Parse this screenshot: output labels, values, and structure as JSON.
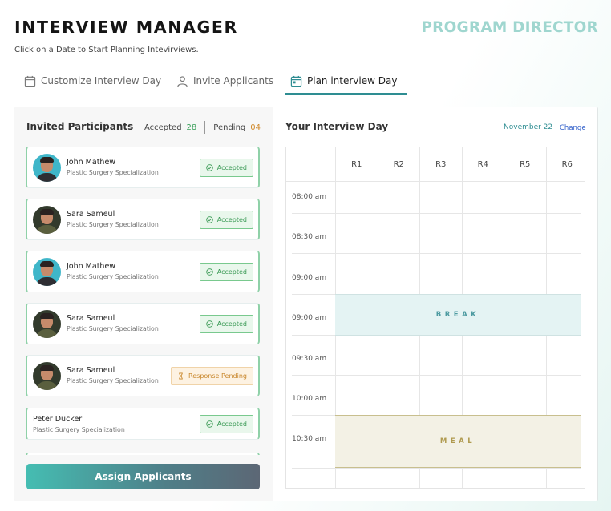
{
  "header": {
    "title": "INTERVIEW MANAGER",
    "role": "PROGRAM DIRECTOR",
    "subtitle": "Click on a Date to Start Planning Intevirviews."
  },
  "tabs": [
    {
      "label": "Customize Interview Day",
      "icon": "calendar-icon",
      "active": false
    },
    {
      "label": "Invite Applicants",
      "icon": "user-icon",
      "active": false
    },
    {
      "label": "Plan interview Day",
      "icon": "calendar-check-icon",
      "active": true
    }
  ],
  "participants": {
    "heading": "Invited Participants",
    "accepted_label": "Accepted",
    "accepted_count": "28",
    "pending_label": "Pending",
    "pending_count": "04",
    "items": [
      {
        "name": "John Mathew",
        "specialization": "Plastic Surgery Specialization",
        "status": "Accepted",
        "status_type": "accepted",
        "avatar": "light"
      },
      {
        "name": "Sara Sameul",
        "specialization": "Plastic Surgery Specialization",
        "status": "Accepted",
        "status_type": "accepted",
        "avatar": "dark"
      },
      {
        "name": "John Mathew",
        "specialization": "Plastic Surgery Specialization",
        "status": "Accepted",
        "status_type": "accepted",
        "avatar": "light"
      },
      {
        "name": "Sara Sameul",
        "specialization": "Plastic Surgery Specialization",
        "status": "Accepted",
        "status_type": "accepted",
        "avatar": "dark"
      },
      {
        "name": "Sara Sameul",
        "specialization": "Plastic Surgery Specialization",
        "status": "Response Pending",
        "status_type": "pending",
        "avatar": "dark"
      },
      {
        "name": "Peter Ducker",
        "specialization": "Plastic Surgery Specialization",
        "status": "Accepted",
        "status_type": "accepted",
        "avatar": "none"
      }
    ],
    "assign_button": "Assign Applicants"
  },
  "interview_day": {
    "heading": "Your Interview Day",
    "date": "November 22",
    "change_link": "Change",
    "rooms": [
      "R1",
      "R2",
      "R3",
      "R4",
      "R5",
      "R6"
    ],
    "times": [
      "08:00 am",
      "08:30 am",
      "09:00 am",
      "09:00 am",
      "09:30 am",
      "10:00 am",
      "10:30 am"
    ],
    "break_label": "BREAK",
    "meal_label": "MEAL"
  },
  "colors": {
    "accent": "#2e8d92",
    "role": "#9fd6cf",
    "accepted": "#3aa05a",
    "pending": "#d08a2c",
    "break_bg": "#e4f3f3",
    "meal_bg": "#f3f1e5"
  }
}
